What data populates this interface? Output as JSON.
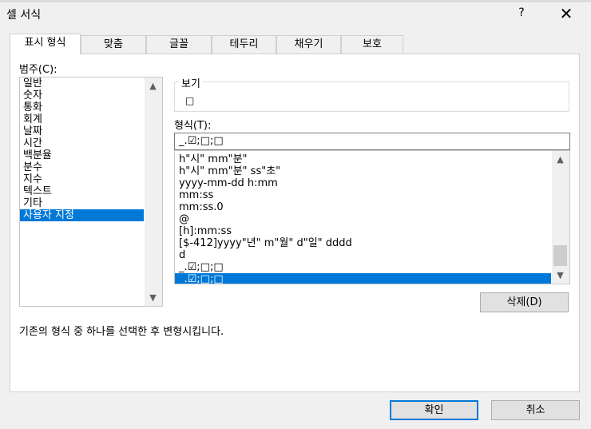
{
  "window": {
    "title": "셀 서식",
    "help_label": "?",
    "close_label": "✕"
  },
  "tabs": [
    {
      "label": "표시 형식",
      "active": true
    },
    {
      "label": "맞춤"
    },
    {
      "label": "글꼴"
    },
    {
      "label": "테두리"
    },
    {
      "label": "채우기"
    },
    {
      "label": "보호"
    }
  ],
  "category": {
    "label": "범주(C):",
    "items": [
      "일반",
      "숫자",
      "통화",
      "회계",
      "날짜",
      "시간",
      "백분율",
      "분수",
      "지수",
      "텍스트",
      "기타",
      "사용자 지정"
    ],
    "selected_index": 11
  },
  "sample": {
    "legend": "보기",
    "value": "□"
  },
  "format": {
    "label": "형식(T):",
    "input_value": "_.☑;□;□",
    "items": [
      "h\"시\" mm\"분\"",
      "h\"시\" mm\"분\" ss\"초\"",
      "yyyy-mm-dd h:mm",
      "mm:ss",
      "mm:ss.0",
      "@",
      "[h]:mm:ss",
      "[$-412]yyyy\"년\" m\"월\" d\"일\" dddd",
      "d",
      "_.☑;□;□",
      "_.☑;□;□"
    ],
    "selected_index": 10
  },
  "buttons": {
    "delete": "삭제(D)",
    "ok": "확인",
    "cancel": "취소"
  },
  "description": "기존의 형식 중 하나를 선택한 후 변형시킵니다."
}
